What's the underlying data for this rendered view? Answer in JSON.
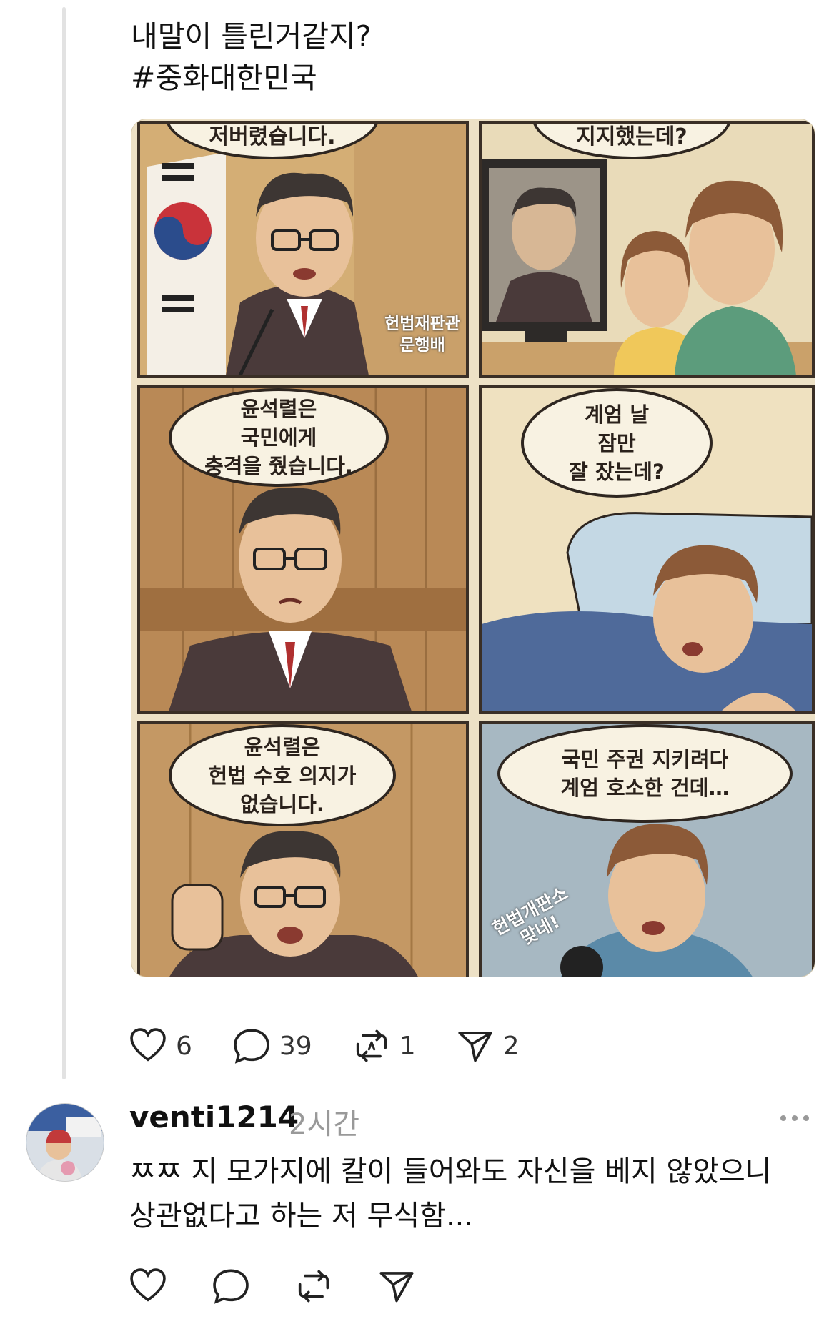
{
  "post": {
    "lines": [
      "내말이 틀린거같지?",
      "#중화대한민국"
    ]
  },
  "comic": {
    "panels": [
      {
        "bubble": "저버렸습니다.",
        "caption": "헌법재판관\n문행배"
      },
      {
        "bubble": "지지했는데?"
      },
      {
        "bubble": "윤석렬은\n국민에게\n충격을 줬습니다."
      },
      {
        "bubble": "계엄 날\n잠만\n잘 잤는데?"
      },
      {
        "bubble": "윤석렬은\n헌법 수호 의지가\n없습니다."
      },
      {
        "bubble": "국민 주권 지키려다\n계엄 호소한 건데…",
        "sign": "헌법개판소\n맞네!"
      }
    ]
  },
  "post_actions": {
    "like_count": "6",
    "reply_count": "39",
    "repost_count": "1",
    "share_count": "2"
  },
  "comment": {
    "username": "venti1214",
    "time": "2시간",
    "text_line1": "ㅉㅉ 지 모가지에 칼이 들어와도 자신을 베지 않았으니",
    "text_line2": "상관없다고 하는 저 무식함..."
  },
  "icons": [
    "heart-icon",
    "comment-icon",
    "repost-icon",
    "share-icon",
    "more-icon"
  ],
  "colors": {
    "text": "#111111",
    "muted": "#999999",
    "icon": "#222222"
  }
}
